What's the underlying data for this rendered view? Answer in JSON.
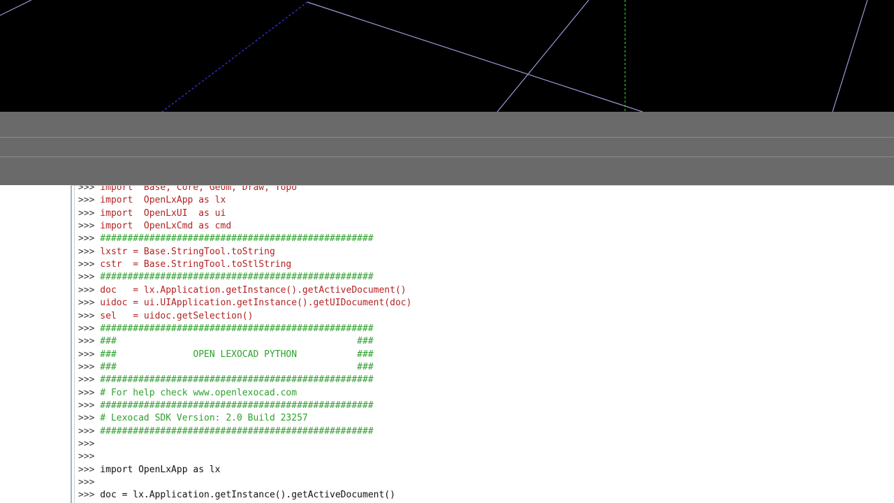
{
  "colors": {
    "viewport_bg": "#000000",
    "splitter_bg": "#6a6a6a",
    "console_bg": "#ffffff",
    "code_red": "#b22222",
    "code_green": "#2ea12e",
    "code_black": "#111111",
    "line_lavender": "#9a9ad8",
    "line_blue_dashed": "#3a3aff",
    "line_green_dashed": "#2ecc2e"
  },
  "console": {
    "prompt": ">>>",
    "lines": [
      {
        "text": " import  Base, Core, Geom, Draw, Topo",
        "color": "red"
      },
      {
        "text": " import  OpenLxApp as lx",
        "color": "red"
      },
      {
        "text": " import  OpenLxUI  as ui",
        "color": "red"
      },
      {
        "text": " import  OpenLxCmd as cmd",
        "color": "red"
      },
      {
        "text": " ##################################################",
        "color": "green"
      },
      {
        "text": " lxstr = Base.StringTool.toString",
        "color": "red"
      },
      {
        "text": " cstr  = Base.StringTool.toStlString",
        "color": "red"
      },
      {
        "text": " ##################################################",
        "color": "green"
      },
      {
        "text": " doc   = lx.Application.getInstance().getActiveDocument()",
        "color": "red"
      },
      {
        "text": " uidoc = ui.UIApplication.getInstance().getUIDocument(doc)",
        "color": "red"
      },
      {
        "text": " sel   = uidoc.getSelection()",
        "color": "red"
      },
      {
        "text": " ##################################################",
        "color": "green"
      },
      {
        "text": " ###                                            ###",
        "color": "green"
      },
      {
        "text": " ###              OPEN LEXOCAD PYTHON           ###",
        "color": "green"
      },
      {
        "text": " ###                                            ###",
        "color": "green"
      },
      {
        "text": " ##################################################",
        "color": "green"
      },
      {
        "text": " # For help check www.openlexocad.com",
        "color": "green"
      },
      {
        "text": " ##################################################",
        "color": "green"
      },
      {
        "text": " # Lexocad SDK Version: 2.0 Build 23257",
        "color": "green"
      },
      {
        "text": " ##################################################",
        "color": "green"
      },
      {
        "text": "",
        "color": "black"
      },
      {
        "text": "",
        "color": "black"
      },
      {
        "text": " import OpenLxApp as lx",
        "color": "black"
      },
      {
        "text": "",
        "color": "black"
      },
      {
        "text": " doc = lx.Application.getInstance().getActiveDocument()",
        "color": "black"
      }
    ]
  }
}
